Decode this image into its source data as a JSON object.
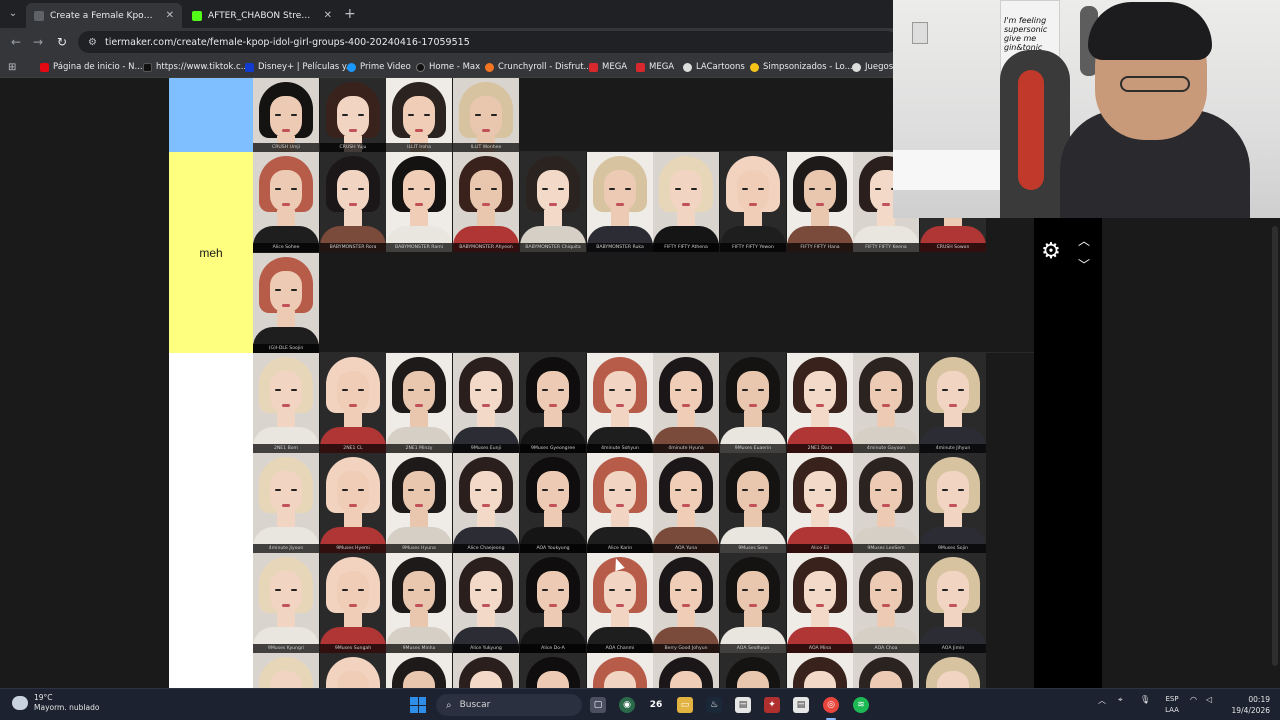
{
  "browser": {
    "tabs": [
      {
        "title": "Create a Female Kpop Idol Girl",
        "active": true,
        "favicon_color": "#5f6368"
      },
      {
        "title": "AFTER_CHABON Stream - Watc",
        "active": false,
        "favicon_color": "#53fc18"
      }
    ],
    "url": "tiermaker.com/create/female-kpop-idol-girl-groups-400-20240416-17059515",
    "bookmarks": [
      {
        "label": "Página de inicio - N...",
        "color": "#e50914"
      },
      {
        "label": "https://www.tiktok.c...",
        "color": "#111111"
      },
      {
        "label": "Disney+ | Películas y...",
        "color": "#113ccf"
      },
      {
        "label": "Prime Video",
        "color": "#1a98ff"
      },
      {
        "label": "Home - Max",
        "color": "#111111"
      },
      {
        "label": "Crunchyroll - Disfrut...",
        "color": "#f47521"
      },
      {
        "label": "MEGA",
        "color": "#d9272e"
      },
      {
        "label": "MEGA",
        "color": "#d9272e"
      },
      {
        "label": "LACartoons",
        "color": "#dddddd"
      },
      {
        "label": "Simpsonizados - Lo...",
        "color": "#f5c518"
      },
      {
        "label": "Juegos",
        "color": "#dddddd"
      }
    ]
  },
  "tiers": [
    {
      "label": "",
      "color": "#80bfff"
    },
    {
      "label": "meh",
      "color": "#ffff7f"
    },
    {
      "label": "",
      "color": "#ffffff"
    }
  ],
  "cards": {
    "tier_top": [
      "CRUSH Umji",
      "CRUSH Yuju",
      "ILLIT Iroha",
      "ILLIT Wonhee"
    ],
    "tier_meh_row1": [
      "Alice Sohee",
      "BABYMONSTER Rora",
      "BABYMONSTER Rami",
      "BABYMONSTER Ahyeon",
      "BABYMONSTER Chiquita",
      "BABYMONSTER Ruka",
      "FIFTY FIFTY Athena",
      "FIFTY FIFTY Yewon",
      "FIFTY FIFTY Hana",
      "FIFTY FIFTY Keena",
      "CRUSH Sowon"
    ],
    "tier_meh_row2": [
      "(G)I-DLE Soojin"
    ],
    "pool_row1": [
      "2NE1 Bom",
      "2NE1 CL",
      "2NE1 Minzy",
      "9Muses Eunji",
      "9Muses Gyeongree",
      "4minute Sohyun",
      "4minute Hyuna",
      "9Muses Euaerin",
      "2NE1 Dara",
      "4minute Gayoon",
      "4minute Jihyun"
    ],
    "pool_row2": [
      "4minute Jiyoon",
      "9Muses Hyemi",
      "9Muses Hyuna",
      "Alice Chaejeong",
      "AOA Youkyung",
      "Alice Karin",
      "AOA Yuna",
      "9Muses Sera",
      "Alice Eli",
      "9Muses LeeSem",
      "9Muses Sojin"
    ],
    "pool_row3": [
      "9Muses Kyungri",
      "9Muses Sungah",
      "9Muses Minha",
      "Alice Yukyung",
      "Alice Do-A",
      "AOA Chanmi",
      "Berry Good Johyun",
      "AOA Seolhyun",
      "AOA Mina",
      "AOA Choa",
      "AOA Jimin"
    ],
    "pool_row4": [
      "",
      "",
      "",
      "",
      "",
      "",
      "",
      "",
      "",
      "",
      ""
    ]
  },
  "controls": {
    "settings_icon": "gear-icon",
    "up_icon": "chevron-up-icon",
    "down_icon": "chevron-down-icon"
  },
  "webcam": {
    "poster_text": "I'm feeling supersonic give me gin&tonic"
  },
  "taskbar": {
    "weather_temp": "19°C",
    "weather_desc": "Mayorm. nublado",
    "search_placeholder": "Buscar",
    "lang_line1": "ESP",
    "lang_line2": "LAA",
    "time": "00:19",
    "date": "19/4/2026",
    "badge": "26"
  }
}
